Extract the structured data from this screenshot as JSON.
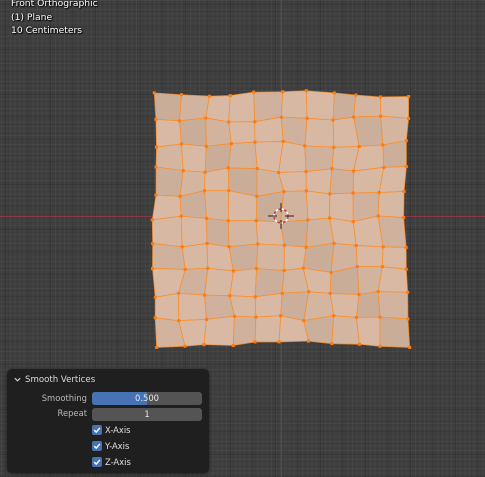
{
  "viewport": {
    "view_name": "Front Orthographic",
    "object_name": "(1) Plane",
    "grid_scale": "10 Centimeters"
  },
  "colors": {
    "mesh_face": "#d9b9a3",
    "mesh_edge": "#ff8a1c",
    "vertex": "#ff7a10",
    "x_axis": "#8a3a46",
    "z_axis": "#36518c",
    "accent": "#4772b3"
  },
  "mesh": {
    "object": "Plane",
    "grid_rows": 11,
    "grid_cols": 11,
    "selected": true
  },
  "cursor_icon": "3d-cursor-icon",
  "operator_panel": {
    "title": "Smooth Vertices",
    "collapse_icon": "chevron-down-icon",
    "smoothing": {
      "label": "Smoothing",
      "value": "0.500",
      "fraction": 0.5
    },
    "repeat": {
      "label": "Repeat",
      "value": "1"
    },
    "axes": [
      {
        "label": "X-Axis",
        "checked": true
      },
      {
        "label": "Y-Axis",
        "checked": true
      },
      {
        "label": "Z-Axis",
        "checked": true
      }
    ]
  }
}
